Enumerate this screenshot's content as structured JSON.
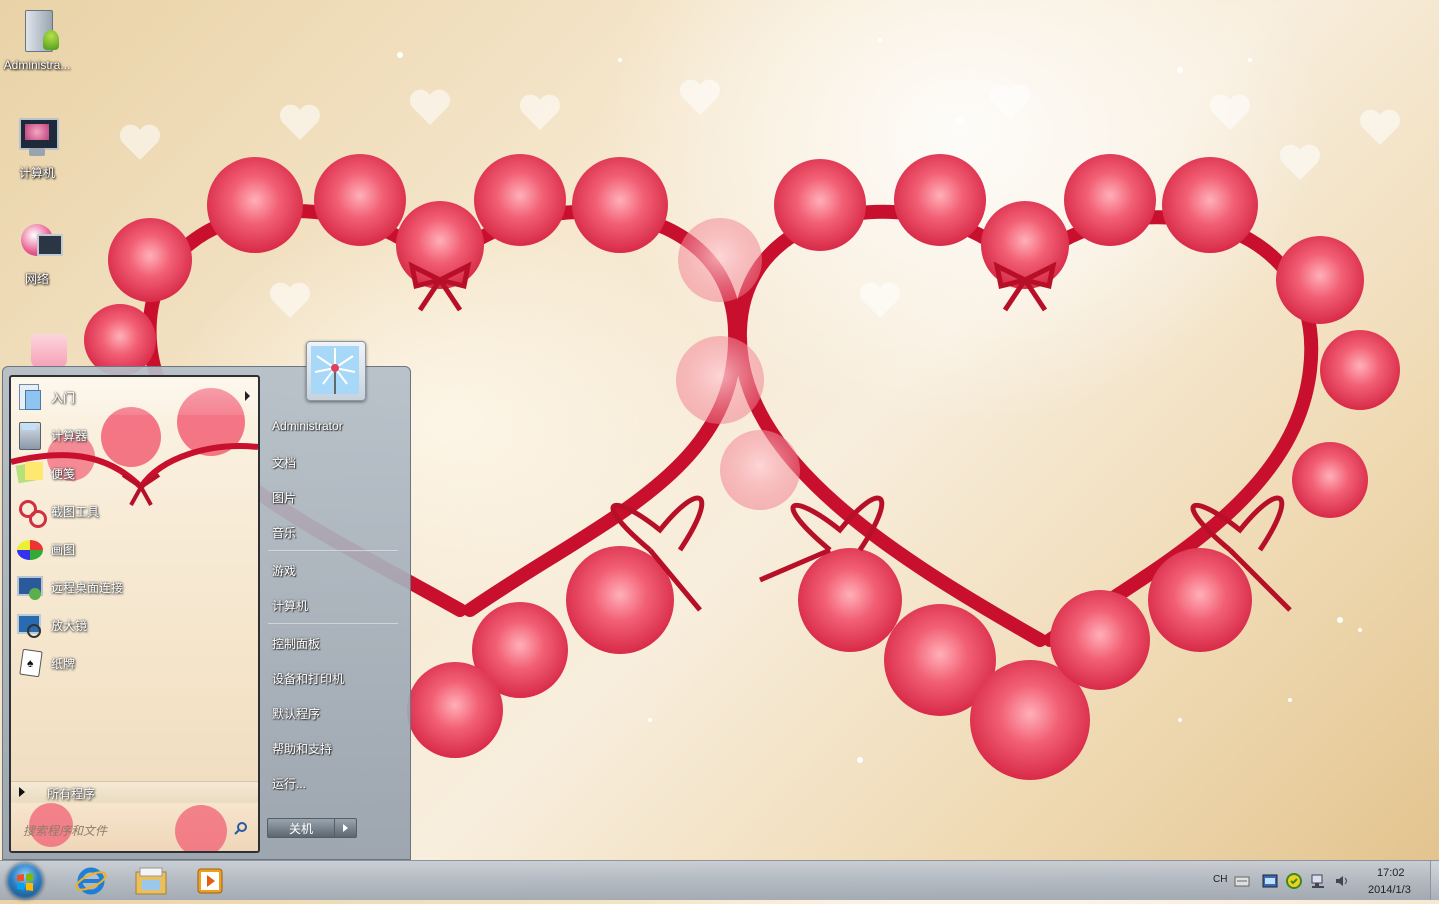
{
  "desktop": {
    "icons": [
      {
        "label": "Administra...",
        "icon": "user-folder-icon"
      },
      {
        "label": "计算机",
        "icon": "computer-icon"
      },
      {
        "label": "网络",
        "icon": "network-icon"
      },
      {
        "label": "",
        "icon": "recycle-bin-icon"
      }
    ]
  },
  "start_menu": {
    "programs": [
      {
        "label": "入门",
        "icon": "getting-started-icon",
        "has_submenu": true
      },
      {
        "label": "计算器",
        "icon": "calculator-icon"
      },
      {
        "label": "便笺",
        "icon": "sticky-notes-icon"
      },
      {
        "label": "截图工具",
        "icon": "snipping-tool-icon"
      },
      {
        "label": "画图",
        "icon": "paint-icon"
      },
      {
        "label": "远程桌面连接",
        "icon": "remote-desktop-icon"
      },
      {
        "label": "放大镜",
        "icon": "magnifier-icon"
      },
      {
        "label": "纸牌",
        "icon": "solitaire-icon"
      }
    ],
    "all_programs": "所有程序",
    "search_placeholder": "搜索程序和文件",
    "right_links": {
      "user": "Administrator",
      "documents": "文档",
      "pictures": "图片",
      "music": "音乐",
      "games": "游戏",
      "computer": "计算机",
      "control_panel": "控制面板",
      "devices_printers": "设备和打印机",
      "default_programs": "默认程序",
      "help_support": "帮助和支持",
      "run": "运行..."
    },
    "shutdown": "关机"
  },
  "taskbar": {
    "pinned": [
      "internet-explorer-icon",
      "windows-explorer-icon",
      "media-player-icon"
    ],
    "tray": {
      "language": "CH",
      "time": "17:02",
      "date": "2014/1/3"
    }
  },
  "colors": {
    "heart_ribbon": "#c8102e",
    "rose": "#f0506a",
    "background": "#f4e6cc"
  }
}
